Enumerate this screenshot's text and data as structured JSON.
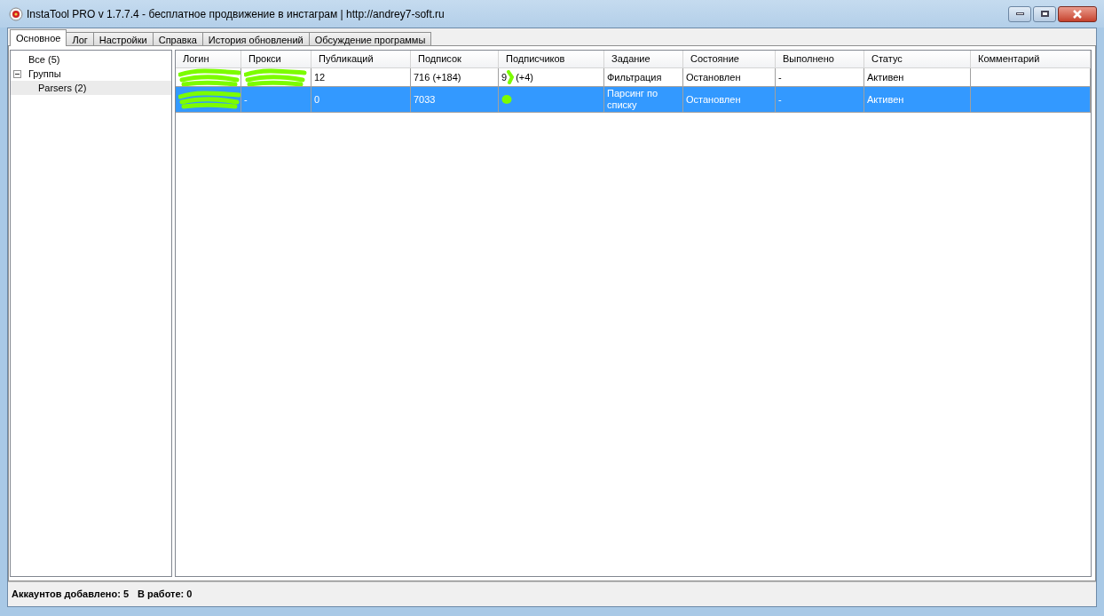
{
  "window": {
    "title": "InstaTool PRO v 1.7.7.4 - бесплатное продвижение в инстаграм | http://andrey7-soft.ru"
  },
  "tabs": [
    {
      "label": "Основное",
      "selected": true
    },
    {
      "label": "Лог",
      "selected": false
    },
    {
      "label": "Настройки",
      "selected": false
    },
    {
      "label": "Справка",
      "selected": false
    },
    {
      "label": "История обновлений",
      "selected": false
    },
    {
      "label": "Обсуждение программы",
      "selected": false
    }
  ],
  "tree": [
    {
      "label": "Все (5)",
      "selected": false
    },
    {
      "label": "Группы",
      "expanded": true,
      "selected": false,
      "children": [
        {
          "label": "Parsers (2)",
          "selected": true
        }
      ]
    }
  ],
  "table": {
    "columns": [
      "Логин",
      "Прокси",
      "Публикаций",
      "Подписок",
      "Подписчиков",
      "Задание",
      "Состояние",
      "Выполнено",
      "Статус",
      "Комментарий"
    ],
    "rows": [
      {
        "selected": false,
        "cells": [
          {
            "kind": "redacted"
          },
          {
            "kind": "redacted"
          },
          {
            "kind": "text",
            "text": "12"
          },
          {
            "kind": "text",
            "text": "716 (+184)"
          },
          {
            "kind": "partly_redacted",
            "before": "9",
            "after": "(+4)"
          },
          {
            "kind": "text",
            "text": "Фильтрация"
          },
          {
            "kind": "text",
            "text": "Остановлен"
          },
          {
            "kind": "text",
            "text": "-"
          },
          {
            "kind": "text",
            "text": "Активен"
          },
          {
            "kind": "empty"
          }
        ]
      },
      {
        "selected": true,
        "cells": [
          {
            "kind": "redacted"
          },
          {
            "kind": "text",
            "text": "-"
          },
          {
            "kind": "text",
            "text": "0"
          },
          {
            "kind": "text",
            "text": "7033"
          },
          {
            "kind": "redacted_small"
          },
          {
            "kind": "text",
            "text": "Парсинг по списку"
          },
          {
            "kind": "text",
            "text": "Остановлен"
          },
          {
            "kind": "text",
            "text": "-"
          },
          {
            "kind": "text",
            "text": "Активен"
          },
          {
            "kind": "empty"
          }
        ]
      }
    ]
  },
  "status_bar": [
    "Аккаунтов добавлено: 5",
    "В работе: 0"
  ]
}
